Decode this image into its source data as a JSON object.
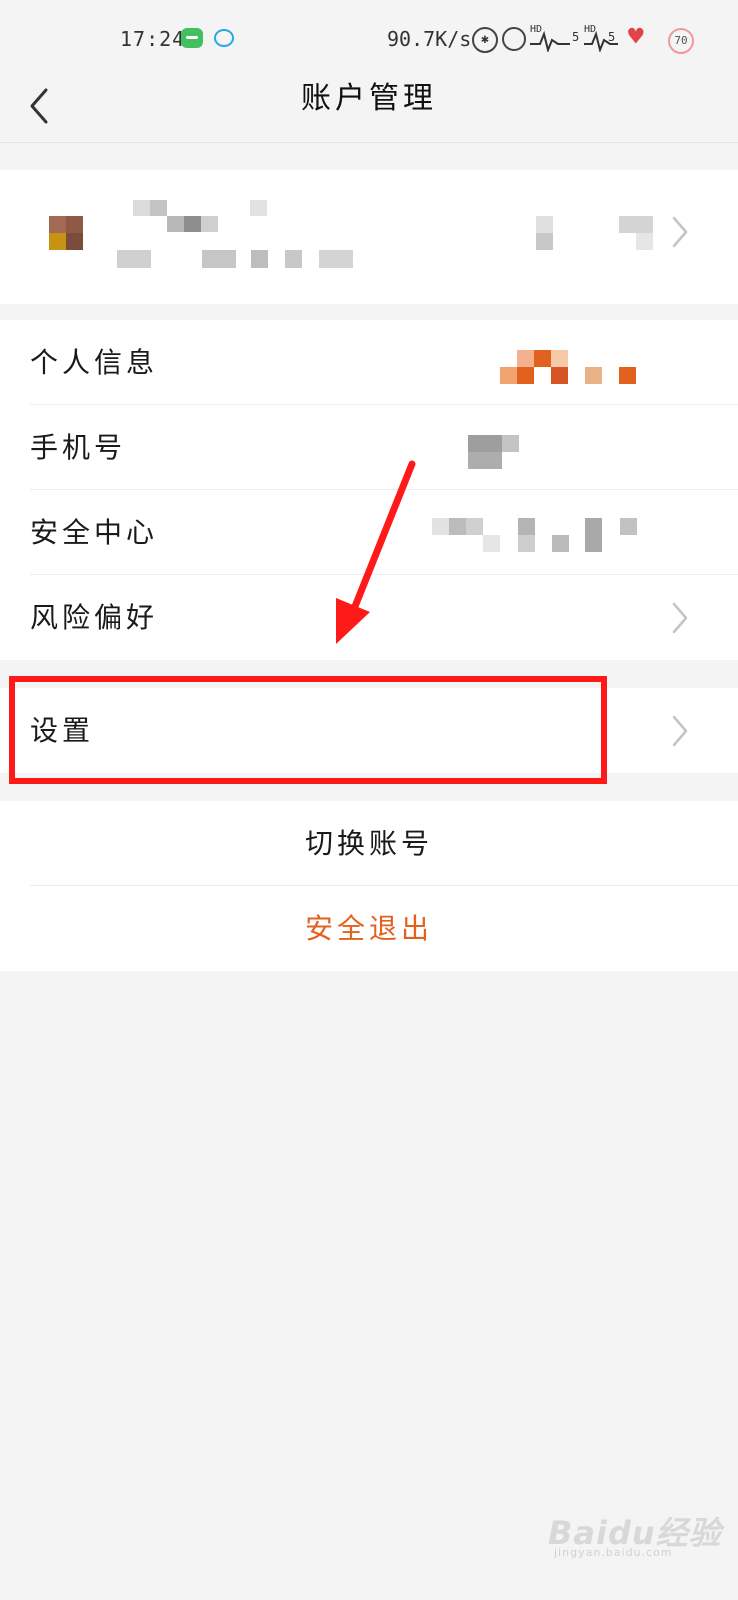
{
  "status_bar": {
    "time": "17:24",
    "net_speed": "90.7K/s",
    "battery": "70",
    "hd_label": "HD",
    "sig_num": "5"
  },
  "nav": {
    "title": "账户管理",
    "back_icon": "chevron-left-icon"
  },
  "menu": {
    "items": [
      {
        "label": "个人信息"
      },
      {
        "label": "手机号"
      },
      {
        "label": "安全中心"
      },
      {
        "label": "风险偏好"
      }
    ],
    "settings": {
      "label": "设置"
    }
  },
  "actions": {
    "switch_account": "切换账号",
    "logout": "安全退出"
  },
  "colors": {
    "accent": "#e2611f",
    "annotation": "#ff1a1a",
    "background": "#f4f4f4"
  },
  "watermark": {
    "brand": "Baidu经验",
    "url": "jingyan.baidu.com"
  }
}
